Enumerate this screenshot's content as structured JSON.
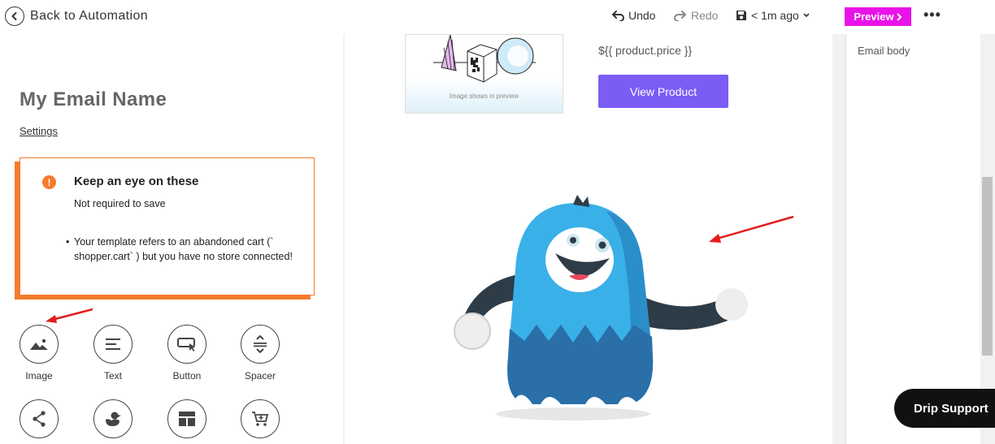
{
  "topbar": {
    "back_label": "Back to Automation",
    "undo_label": "Undo",
    "redo_label": "Redo",
    "saved_label": "< 1m ago",
    "preview_label": "Preview",
    "more_label": "•••"
  },
  "left_panel": {
    "email_name": "My Email Name",
    "settings_label": "Settings",
    "warning": {
      "title": "Keep an eye on these",
      "subtitle": "Not required to save",
      "bullet": "Your template refers to an abandoned cart (` shopper.cart` ) but you have no store connected!"
    },
    "tools": [
      {
        "label": "Image",
        "icon": "image-icon"
      },
      {
        "label": "Text",
        "icon": "text-icon"
      },
      {
        "label": "Button",
        "icon": "button-icon"
      },
      {
        "label": "Spacer",
        "icon": "spacer-icon"
      },
      {
        "label": "",
        "icon": "share-icon"
      },
      {
        "label": "",
        "icon": "duck-icon"
      },
      {
        "label": "",
        "icon": "layout-icon"
      },
      {
        "label": "",
        "icon": "cart-icon"
      }
    ]
  },
  "canvas": {
    "image_caption": "Image shows in preview",
    "price": "${{ product.price }}",
    "view_product_label": "View Product"
  },
  "right_panel": {
    "label": "Email body"
  },
  "support_label": "Drip Support",
  "colors": {
    "accent_magenta": "#e913e9",
    "button_purple": "#7b5cf5",
    "warning_orange": "#f57a2d",
    "arrow_red": "#e21c1c"
  }
}
